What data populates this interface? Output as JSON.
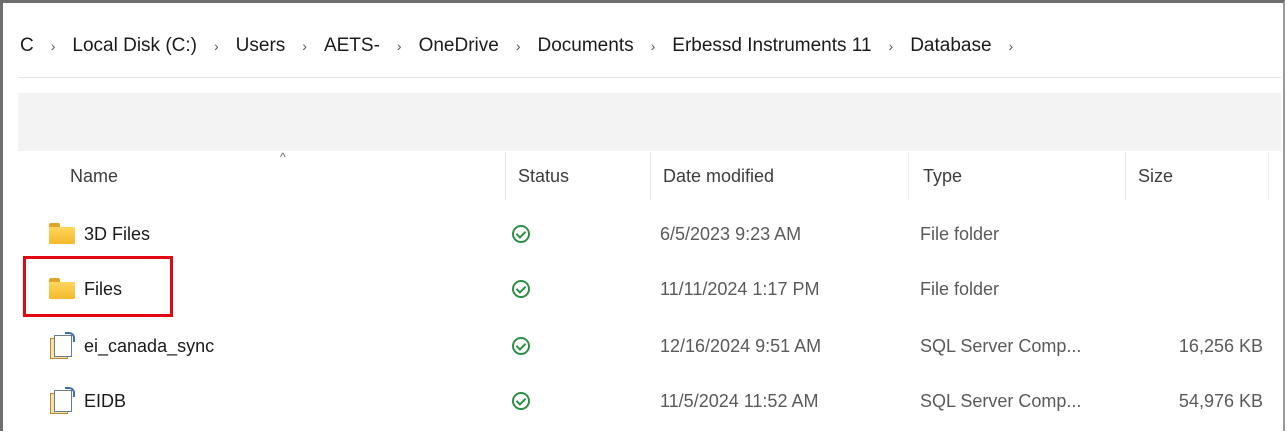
{
  "breadcrumb": {
    "items": [
      "C",
      "Local Disk (C:)",
      "Users",
      "AETS-",
      "OneDrive",
      "Documents",
      "Erbessd Instruments 11",
      "Database"
    ],
    "separator": "›"
  },
  "columns": {
    "name": "Name",
    "status": "Status",
    "date_modified": "Date modified",
    "type": "Type",
    "size": "Size"
  },
  "files": [
    {
      "name": "3D Files",
      "icon": "folder-icon",
      "status": "synced",
      "date": "6/5/2023 9:23 AM",
      "type": "File folder",
      "size": ""
    },
    {
      "name": "Files",
      "icon": "folder-icon",
      "status": "synced",
      "date": "11/11/2024 1:17 PM",
      "type": "File folder",
      "size": ""
    },
    {
      "name": "ei_canada_sync",
      "icon": "sql-database-file-icon",
      "status": "synced",
      "date": "12/16/2024 9:51 AM",
      "type": "SQL Server Comp...",
      "size": "16,256 KB"
    },
    {
      "name": "EIDB",
      "icon": "sql-database-file-icon",
      "status": "synced",
      "date": "11/5/2024 11:52 AM",
      "type": "SQL Server Comp...",
      "size": "54,976 KB"
    }
  ],
  "colors": {
    "highlight": "#e30613",
    "folder": "#f3b92c",
    "status_ok": "#2f8f47",
    "command_bar": "#f3f3f3"
  }
}
